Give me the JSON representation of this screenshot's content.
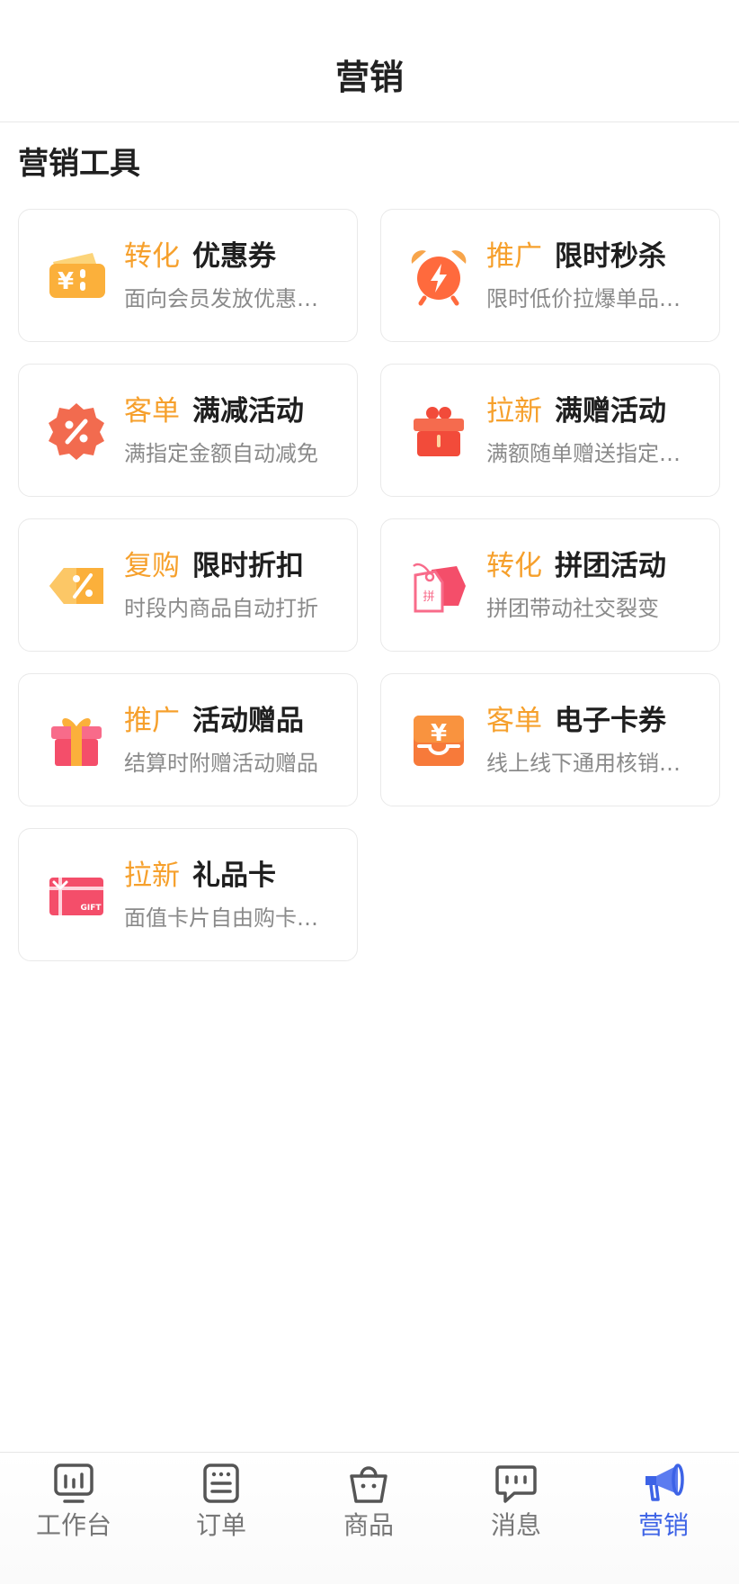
{
  "header": {
    "title": "营销"
  },
  "section": {
    "title": "营销工具"
  },
  "tools": [
    {
      "tag": "转化",
      "name": "优惠券",
      "desc": "面向会员发放优惠…",
      "icon": "coupon-icon"
    },
    {
      "tag": "推广",
      "name": "限时秒杀",
      "desc": "限时低价拉爆单品…",
      "icon": "alarm-clock-icon"
    },
    {
      "tag": "客单",
      "name": "满减活动",
      "desc": "满指定金额自动减免",
      "icon": "percent-badge-icon"
    },
    {
      "tag": "拉新",
      "name": "满赠活动",
      "desc": "满额随单赠送指定…",
      "icon": "gift-box-icon"
    },
    {
      "tag": "复购",
      "name": "限时折扣",
      "desc": "时段内商品自动打折",
      "icon": "discount-tag-icon"
    },
    {
      "tag": "转化",
      "name": "拼团活动",
      "desc": "拼团带动社交裂变",
      "icon": "group-buy-tag-icon"
    },
    {
      "tag": "推广",
      "name": "活动赠品",
      "desc": "结算时附赠活动赠品",
      "icon": "present-icon"
    },
    {
      "tag": "客单",
      "name": "电子卡券",
      "desc": "线上线下通用核销…",
      "icon": "e-voucher-icon"
    },
    {
      "tag": "拉新",
      "name": "礼品卡",
      "desc": "面值卡片自由购卡…",
      "icon": "gift-card-icon"
    }
  ],
  "tabbar": {
    "items": [
      {
        "label": "工作台",
        "icon": "dashboard-icon"
      },
      {
        "label": "订单",
        "icon": "order-icon"
      },
      {
        "label": "商品",
        "icon": "shopping-bag-icon"
      },
      {
        "label": "消息",
        "icon": "message-icon"
      },
      {
        "label": "营销",
        "icon": "megaphone-icon"
      }
    ],
    "active": "营销"
  },
  "colors": {
    "accent": "#3d63e6",
    "tag": "#f6a02c",
    "text": "#1f1f1f",
    "muted": "#8a8a8a"
  },
  "icon_text": {
    "group_buy": "拼",
    "gift_card": "GIFT",
    "currency": "¥"
  }
}
